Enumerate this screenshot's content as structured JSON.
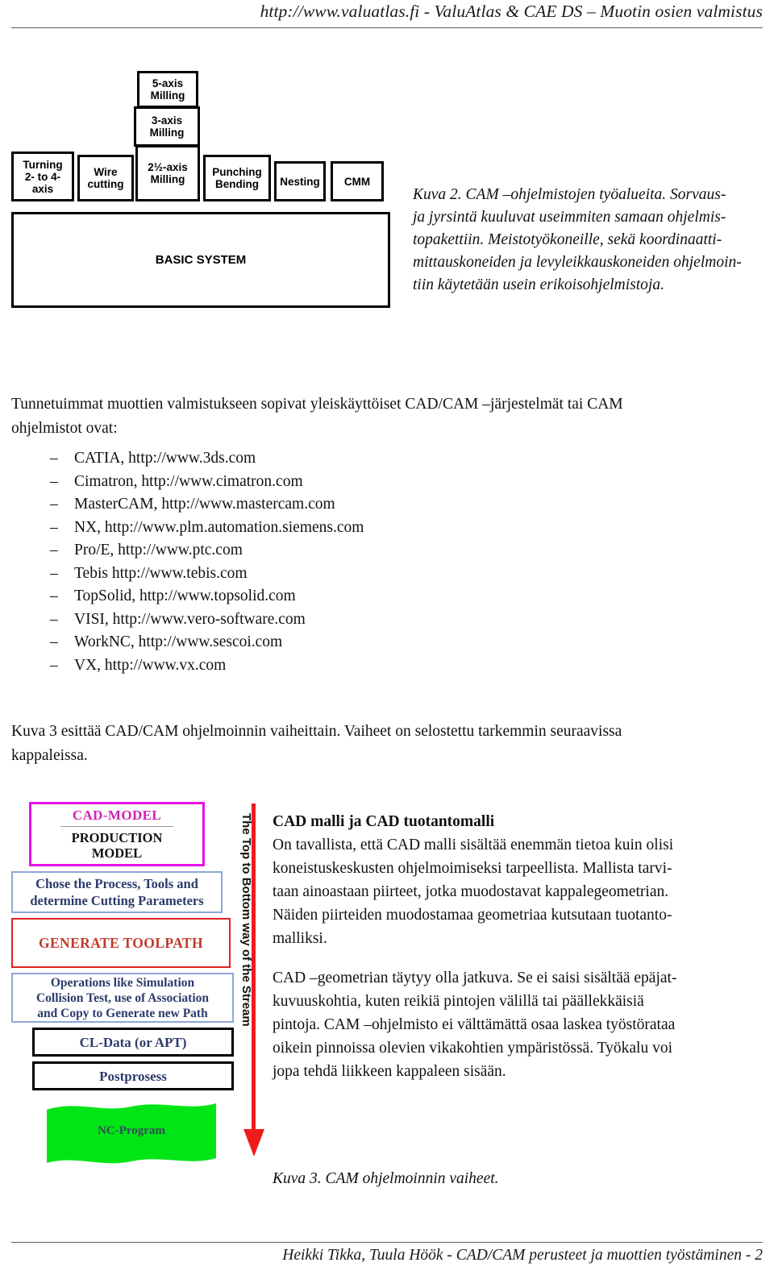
{
  "header": {
    "url_title": "http://www.valuatlas.fi - ValuAtlas & CAE DS – Muotin osien valmistus"
  },
  "figure2": {
    "boxes": [
      {
        "id": "turning",
        "label": "Turning\n2- to 4-\naxis"
      },
      {
        "id": "wire",
        "label": "Wire\ncutting"
      },
      {
        "id": "mill25",
        "label": "2½-axis\nMilling"
      },
      {
        "id": "mill3",
        "label": "3-axis\nMilling"
      },
      {
        "id": "mill5",
        "label": "5-axis\nMilling"
      },
      {
        "id": "punching",
        "label": "Punching\nBending"
      },
      {
        "id": "nesting",
        "label": "Nesting"
      },
      {
        "id": "cmm",
        "label": "CMM"
      }
    ],
    "base_label": "BASIC SYSTEM",
    "caption_lines": [
      "Kuva 2.  CAM –ohjelmistojen  työalueita.  Sorvaus-",
      "ja jyrsintä kuuluvat useimmiten samaan ohjelmis-",
      "topakettiin.  Meistotyökoneille,  sekä  koordinaatti-",
      "mittauskoneiden ja levyleikkauskoneiden ohjelmoin-",
      "tiin käytetään usein erikoisohjelmistoja."
    ]
  },
  "body": {
    "intro_lines": [
      "Tunnetuimmat  muottien  valmistukseen  sopivat  yleiskäyttöiset  CAD/CAM  –järjestelmät  tai  CAM",
      "ohjelmistot ovat:"
    ],
    "dash": "–",
    "software_list": [
      "CATIA, http://www.3ds.com",
      "Cimatron, http://www.cimatron.com",
      "MasterCAM, http://www.mastercam.com",
      "NX, http://www.plm.automation.siemens.com",
      "Pro/E, http://www.ptc.com",
      "Tebis http://www.tebis.com",
      "TopSolid, http://www.topsolid.com",
      "VISI, http://www.vero-software.com",
      "WorkNC, http://www.sescoi.com",
      "VX, http://www.vx.com"
    ],
    "kuva3_lead_lines": [
      "Kuva 3 esittää CAD/CAM ohjelmoinnin vaiheittain. Vaiheet on selostettu tarkemmin seuraavissa",
      "kappaleissa."
    ]
  },
  "figure3": {
    "cad_model_title": "CAD-MODEL",
    "cad_model_sub": "PRODUCTION\nMODEL",
    "chose_box": "Chose the Process, Tools and\ndetermine Cutting Parameters",
    "generate_box": "GENERATE TOOLPATH",
    "operations_box": "Operations like Simulation\nCollision Test, use of Association\nand Copy to Generate new Path",
    "cl_data_box": "CL-Data (or APT)",
    "postprocess_box": "Postprosess",
    "nc_program_box": "NC-Program",
    "stream_label": "The Top to Bottom way of the Stream",
    "caption": "Kuva 3.  CAM ohjelmoinnin vaiheet.",
    "colors": {
      "cad_border": "#e612e6",
      "cad_title": "#cf23b4",
      "blue_border": "#8ea6d8",
      "navy_text": "#2b3a6b",
      "red_border": "#e02121",
      "red_text": "#c0392b",
      "arrow_red": "#ee1c1c",
      "nc_green": "#00e515"
    }
  },
  "right_column": {
    "heading": "CAD malli ja CAD tuotantomalli",
    "para1_lines": [
      "On tavallista, että CAD malli sisältää enemmän tietoa kuin olisi",
      "koneistuskeskusten  ohjelmoimiseksi  tarpeellista.  Mallista  tarvi-",
      "taan  ainoastaan  piirteet,  jotka  muodostavat  kappalegeometrian.",
      "Näiden piirteiden muodostamaa geometriaa kutsutaan tuotanto-",
      "malliksi."
    ],
    "para2_lines": [
      "CAD –geometrian täytyy olla jatkuva. Se ei saisi sisältää epäjat-",
      "kuvuuskohtia,  kuten  reikiä  pintojen  välillä  tai  päällekkäisiä",
      "pintoja. CAM –ohjelmisto ei välttämättä osaa laskea työstörataa",
      "oikein pinnoissa olevien vikakohtien ympäristössä. Työkalu voi",
      "jopa tehdä liikkeen kappaleen sisään."
    ]
  },
  "footer": {
    "text": "Heikki Tikka, Tuula Höök - CAD/CAM perusteet ja muottien työstäminen - 2"
  }
}
